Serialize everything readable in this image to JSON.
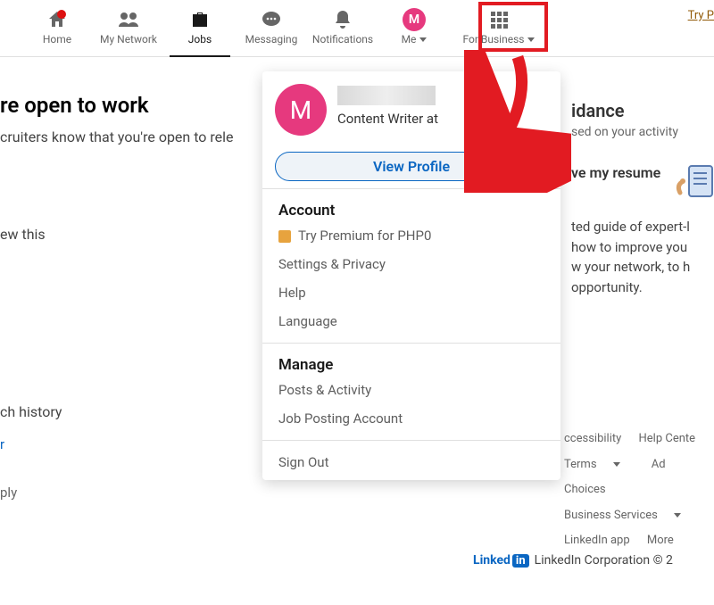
{
  "nav": {
    "home": "Home",
    "network": "My Network",
    "jobs": "Jobs",
    "messaging": "Messaging",
    "notifications": "Notifications",
    "me": "Me",
    "business": "For Business",
    "try_premium": "Try P",
    "avatar_letter": "M"
  },
  "left": {
    "headline": "re open to work",
    "sub": "cruiters know that you're open to rele",
    "ew_this": "ew this",
    "ch_history": "ch history",
    "r": "r",
    "ply": "ply"
  },
  "dropdown": {
    "avatar_letter": "M",
    "subtitle": "Content Writer at",
    "view_profile": "View Profile",
    "account_title": "Account",
    "premium": "Try Premium for PHP0",
    "settings": "Settings & Privacy",
    "help": "Help",
    "language": "Language",
    "manage_title": "Manage",
    "posts": "Posts & Activity",
    "job_posting": "Job Posting Account",
    "sign_out": "Sign Out"
  },
  "right": {
    "title": "idance",
    "sub": "sed on your activity",
    "card_title": "ve my resume",
    "desc1": "ted guide of expert-l",
    "desc2": "how to improve you",
    "desc3": "w your network, to h",
    "desc4": "opportunity."
  },
  "footer": {
    "accessibility": "ccessibility",
    "help_center": "Help Cente",
    "terms": "Terms",
    "ad_choices": "Ad Choices",
    "biz_services": "Business Services",
    "get_app": "LinkedIn app",
    "more": "More",
    "corp": "LinkedIn Corporation © 2",
    "linked": "Linked",
    "in": "in"
  }
}
